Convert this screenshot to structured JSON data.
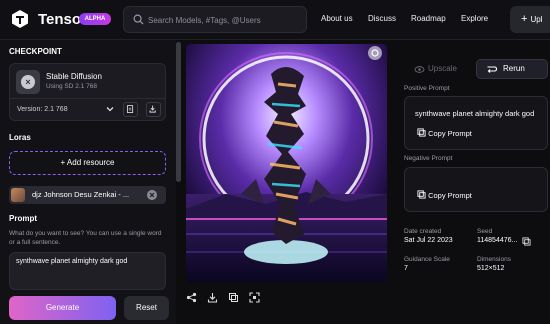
{
  "header": {
    "brand": "Tensor",
    "badge": "ALPHA",
    "search_placeholder": "Search Models, #Tags, @Users",
    "nav": [
      "About us",
      "Discuss",
      "Roadmap",
      "Explore"
    ],
    "upload_label": "Upl"
  },
  "left": {
    "checkpoint_title": "CHECKPOINT",
    "checkpoint_name": "Stable Diffusion",
    "checkpoint_sub": "Using SD 2.1 768",
    "version": "Version: 2.1 768",
    "loras_title": "Loras",
    "add_resource": "+ Add resource",
    "lora_name": "djz Johnson Desu Zenkai - ...",
    "prompt_title": "Prompt",
    "prompt_help": "What do you want to see? You can use a single word or a full sentence.",
    "prompt_value": "synthwave planet almighty dark god",
    "generate_label": "Generate",
    "reset_label": "Reset"
  },
  "right": {
    "upscale_label": "Upscale",
    "rerun_label": "Rerun",
    "positive_title": "Positive Prompt",
    "positive_value": "synthwave planet almighty dark god",
    "copy_label": "Copy Prompt",
    "negative_title": "Negative Prompt",
    "date_label": "Date created",
    "date_value": "Sat Jul 22 2023",
    "seed_label": "Seed",
    "seed_value": "114854476...",
    "guidance_label": "Guidance Scale",
    "guidance_value": "7",
    "dimensions_label": "Dimensions",
    "dimensions_value": "512×512"
  },
  "colors": {
    "accent_purple": "#8a3cf5",
    "generate_gradient_start": "#e065c8",
    "generate_gradient_end": "#7e62f0"
  }
}
